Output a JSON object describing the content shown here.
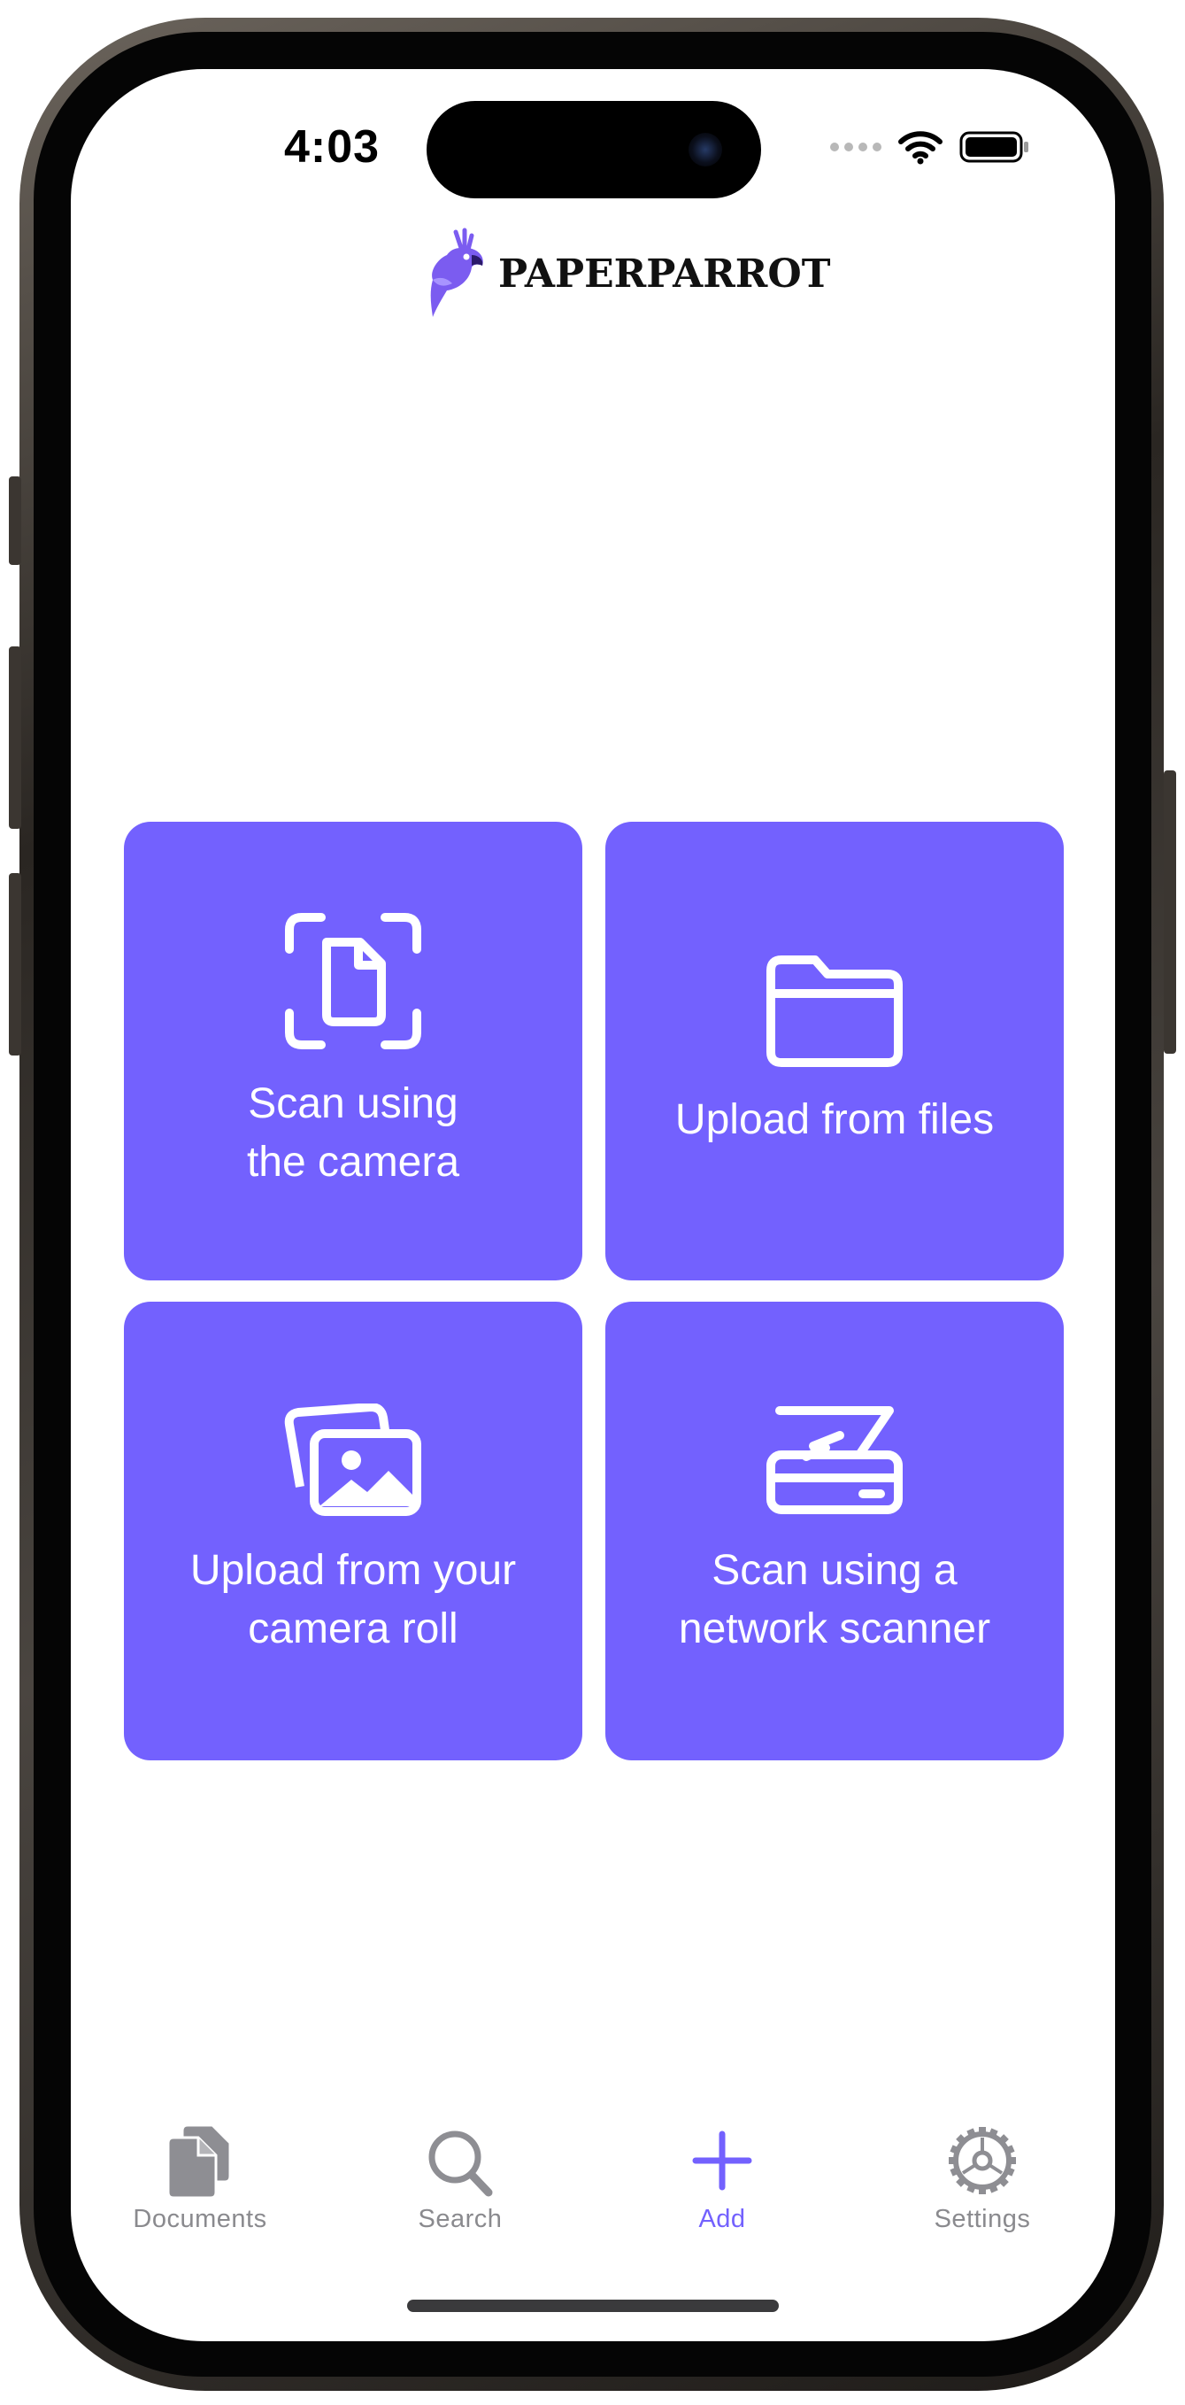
{
  "status_bar": {
    "time": "4:03",
    "icons": [
      "signal-dots-icon",
      "wifi-icon",
      "battery-icon"
    ]
  },
  "header": {
    "logo_text": "PAPERPARROT",
    "logo_icon": "parrot-logo-icon"
  },
  "actions": [
    {
      "label": "Scan using\nthe camera",
      "icon": "document-scan-icon"
    },
    {
      "label": "Upload from files",
      "icon": "folder-icon"
    },
    {
      "label": "Upload from your\ncamera roll",
      "icon": "photos-icon"
    },
    {
      "label": "Scan using a\nnetwork scanner",
      "icon": "scanner-icon"
    }
  ],
  "tab_bar": {
    "active": "Add",
    "tabs": [
      {
        "label": "Documents",
        "icon": "documents-icon"
      },
      {
        "label": "Search",
        "icon": "search-icon"
      },
      {
        "label": "Add",
        "icon": "plus-icon"
      },
      {
        "label": "Settings",
        "icon": "gear-icon"
      }
    ]
  },
  "colors": {
    "accent": "#7361fe",
    "tab_inactive": "#8a8a8e",
    "logo_purple": "#7b5cf0"
  }
}
